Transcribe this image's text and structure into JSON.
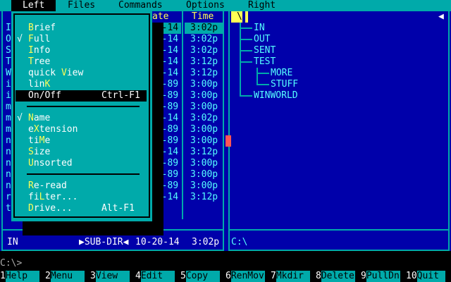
{
  "menubar": {
    "items": [
      "Left",
      "Files",
      "Commands",
      "Options",
      "Right"
    ]
  },
  "left_panel": {
    "columns": {
      "date": "ate",
      "time": "Time"
    },
    "name_initials": [
      "I",
      "O",
      "S",
      "T",
      "W",
      "i",
      "i",
      "m",
      "m",
      "m",
      "n",
      "n",
      "n",
      "n",
      "n",
      "r",
      "t"
    ],
    "rows": [
      {
        "date": "20-14",
        "time": "3:02p"
      },
      {
        "date": "20-14",
        "time": "3:02p"
      },
      {
        "date": "20-14",
        "time": "3:02p"
      },
      {
        "date": "20-14",
        "time": "3:12p"
      },
      {
        "date": "20-14",
        "time": "3:12p"
      },
      {
        "date": "23-89",
        "time": "3:00p"
      },
      {
        "date": "23-89",
        "time": "3:00p"
      },
      {
        "date": "23-89",
        "time": "3:00p"
      },
      {
        "date": "20-14",
        "time": "3:02p"
      },
      {
        "date": "23-89",
        "time": "3:00p"
      },
      {
        "date": "23-89",
        "time": "3:00p"
      },
      {
        "date": "20-14",
        "time": "3:12p"
      },
      {
        "date": "23-89",
        "time": "3:00p"
      },
      {
        "date": "23-89",
        "time": "3:00p"
      },
      {
        "date": "23-89",
        "time": "3:00p"
      },
      {
        "date": "20-14",
        "time": "3:12p"
      }
    ],
    "status": {
      "name": "IN",
      "type": "▶SUB-DIR◀",
      "date": "10-20-14",
      "time": "3:02p"
    }
  },
  "dropdown": {
    "group1": [
      {
        "check": " ",
        "pre": "",
        "hot": "B",
        "post": "rief",
        "shortcut": ""
      },
      {
        "check": "√",
        "pre": "",
        "hot": "F",
        "post": "ull",
        "shortcut": ""
      },
      {
        "check": " ",
        "pre": "",
        "hot": "I",
        "post": "nfo",
        "shortcut": ""
      },
      {
        "check": " ",
        "pre": "",
        "hot": "T",
        "post": "ree",
        "shortcut": ""
      },
      {
        "check": " ",
        "pre": "quick ",
        "hot": "V",
        "post": "iew",
        "shortcut": ""
      },
      {
        "check": " ",
        "pre": "lin",
        "hot": "K",
        "post": "",
        "shortcut": ""
      },
      {
        "check": " ",
        "pre": "",
        "hot": "O",
        "post": "n/Off",
        "shortcut": "Ctrl-F1",
        "selected": true
      }
    ],
    "group2": [
      {
        "check": "√",
        "pre": "",
        "hot": "N",
        "post": "ame",
        "shortcut": ""
      },
      {
        "check": " ",
        "pre": "e",
        "hot": "X",
        "post": "tension",
        "shortcut": ""
      },
      {
        "check": " ",
        "pre": "ti",
        "hot": "M",
        "post": "e",
        "shortcut": ""
      },
      {
        "check": " ",
        "pre": "",
        "hot": "S",
        "post": "ize",
        "shortcut": ""
      },
      {
        "check": " ",
        "pre": "",
        "hot": "U",
        "post": "nsorted",
        "shortcut": ""
      }
    ],
    "group3": [
      {
        "check": " ",
        "pre": "",
        "hot": "R",
        "post": "e-read",
        "shortcut": ""
      },
      {
        "check": " ",
        "pre": "fi",
        "hot": "L",
        "post": "ter...",
        "shortcut": ""
      },
      {
        "check": " ",
        "pre": "",
        "hot": "D",
        "post": "rive...",
        "shortcut": "Alt-F1"
      }
    ]
  },
  "right_panel": {
    "root_marker": "\\",
    "tree": [
      {
        "label": "IN",
        "level": 1
      },
      {
        "label": "OUT",
        "level": 1
      },
      {
        "label": "SENT",
        "level": 1
      },
      {
        "label": "TEST",
        "level": 1
      },
      {
        "label": "MORE",
        "level": 2
      },
      {
        "label": "STUFF",
        "level": 2
      },
      {
        "label": "WINWORLD",
        "level": 1
      }
    ],
    "path": "C:\\"
  },
  "command_line": "C:\\>",
  "keybar": [
    {
      "num": "1",
      "label": "Help"
    },
    {
      "num": "2",
      "label": "Menu"
    },
    {
      "num": "3",
      "label": "View"
    },
    {
      "num": "4",
      "label": "Edit"
    },
    {
      "num": "5",
      "label": "Copy"
    },
    {
      "num": "6",
      "label": "RenMov"
    },
    {
      "num": "7",
      "label": "Mkdir"
    },
    {
      "num": "8",
      "label": "Delete"
    },
    {
      "num": "9",
      "label": "PullDn"
    },
    {
      "num": "10",
      "label": "Quit"
    }
  ]
}
